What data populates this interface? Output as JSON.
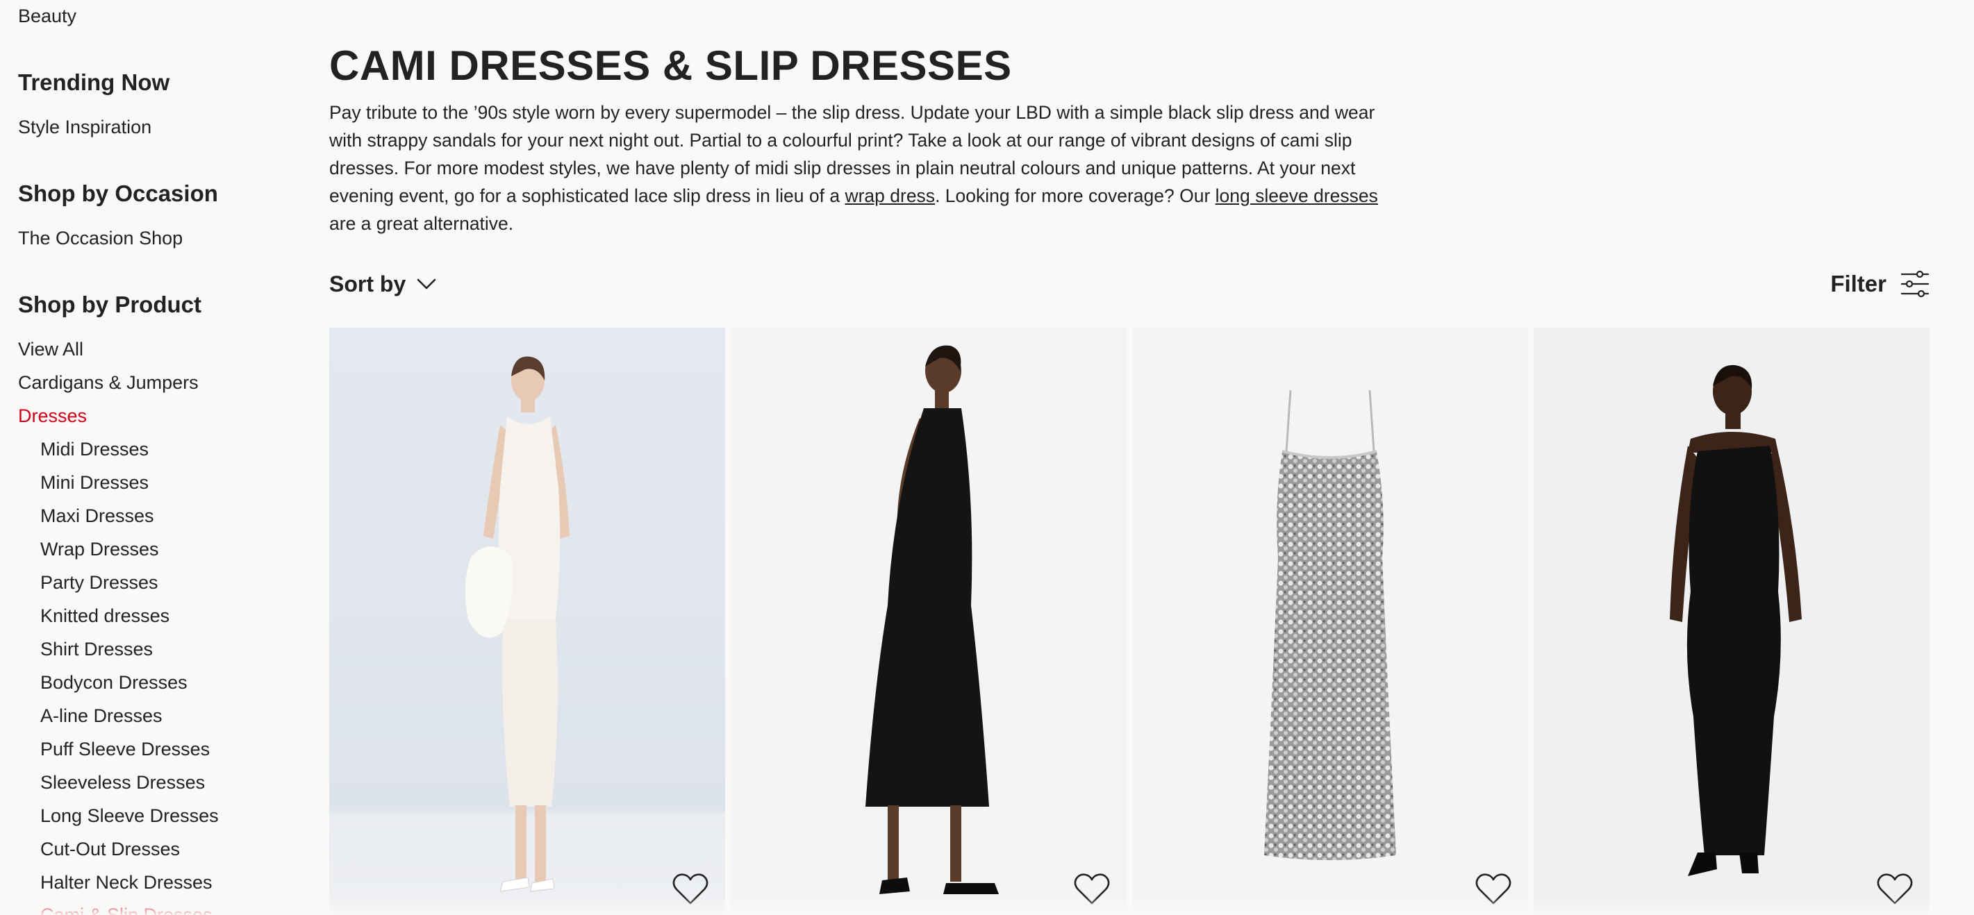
{
  "sidebar": {
    "beauty": "Beauty",
    "trending_heading": "Trending Now",
    "style_inspiration": "Style Inspiration",
    "occasion_heading": "Shop by Occasion",
    "occasion_shop": "The Occasion Shop",
    "product_heading": "Shop by Product",
    "view_all": "View All",
    "cardigans": "Cardigans & Jumpers",
    "dresses": "Dresses",
    "sub_items": [
      "Midi Dresses",
      "Mini Dresses",
      "Maxi Dresses",
      "Wrap Dresses",
      "Party Dresses",
      "Knitted dresses",
      "Shirt Dresses",
      "Bodycon Dresses",
      "A-line Dresses",
      "Puff Sleeve Dresses",
      "Sleeveless Dresses",
      "Long Sleeve Dresses",
      "Cut-Out Dresses",
      "Halter Neck Dresses",
      "Cami & Slip Dresses"
    ]
  },
  "main": {
    "title": "CAMI DRESSES & SLIP DRESSES",
    "description": {
      "part1": "Pay tribute to the ’90s style worn by every supermodel – the slip dress. Update your LBD with a simple black slip dress and wear with strappy sandals for your next night out. Partial to a colourful print? Take a look at our range of vibrant designs of cami slip dresses. For more modest styles, we have plenty of midi slip dresses in plain neutral colours and unique patterns. At your next evening event, go for a sophisticated lace slip dress in lieu of a ",
      "link1": "wrap dress",
      "part2": ". Looking for more coverage? Our ",
      "link2": "long sleeve dresses",
      "part3": " are a great alternative."
    },
    "sort_label": "Sort by",
    "filter_label": "Filter"
  },
  "icons": {
    "sort": "chevron-down-icon",
    "filter": "sliders-icon",
    "favourite": "heart-icon"
  },
  "colors": {
    "page_bg": "#faf9f8",
    "text": "#222222",
    "active": "#d0021b"
  }
}
